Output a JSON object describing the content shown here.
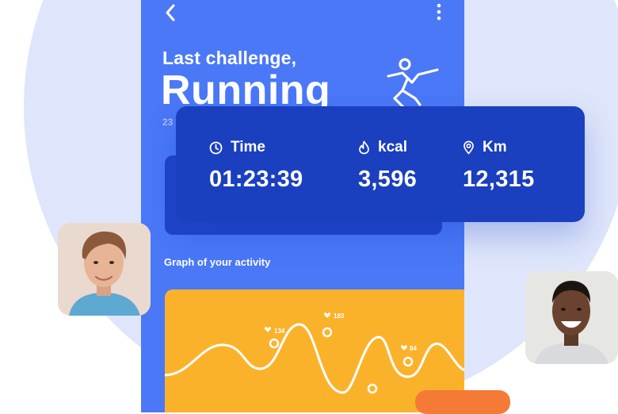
{
  "header": {
    "back_icon": "chevron-left-icon",
    "menu_icon": "more-vertical-icon",
    "subtitle": "Last challenge,",
    "title": "Running",
    "date_fragment": "23",
    "activity_icon": "runner-icon"
  },
  "stats": [
    {
      "icon": "clock-icon",
      "label": "Time",
      "value": "01:23:39"
    },
    {
      "icon": "flame-icon",
      "label": "kcal",
      "value": "3,596"
    },
    {
      "icon": "location-pin-icon",
      "label": "Km",
      "value": "12,315"
    }
  ],
  "graph": {
    "title": "Graph of your activity",
    "markers": [
      {
        "icon": "heart-icon",
        "value": "134"
      },
      {
        "icon": "heart-icon",
        "value": "183"
      },
      {
        "icon": "heart-icon",
        "value": "84"
      }
    ]
  },
  "colors": {
    "page_circle": "#dfe6fb",
    "phone_bg": "#4a78f7",
    "stats_card": "#1a3fbf",
    "graph_bg": "#fbb22b",
    "accent_orange": "#f47a35"
  }
}
